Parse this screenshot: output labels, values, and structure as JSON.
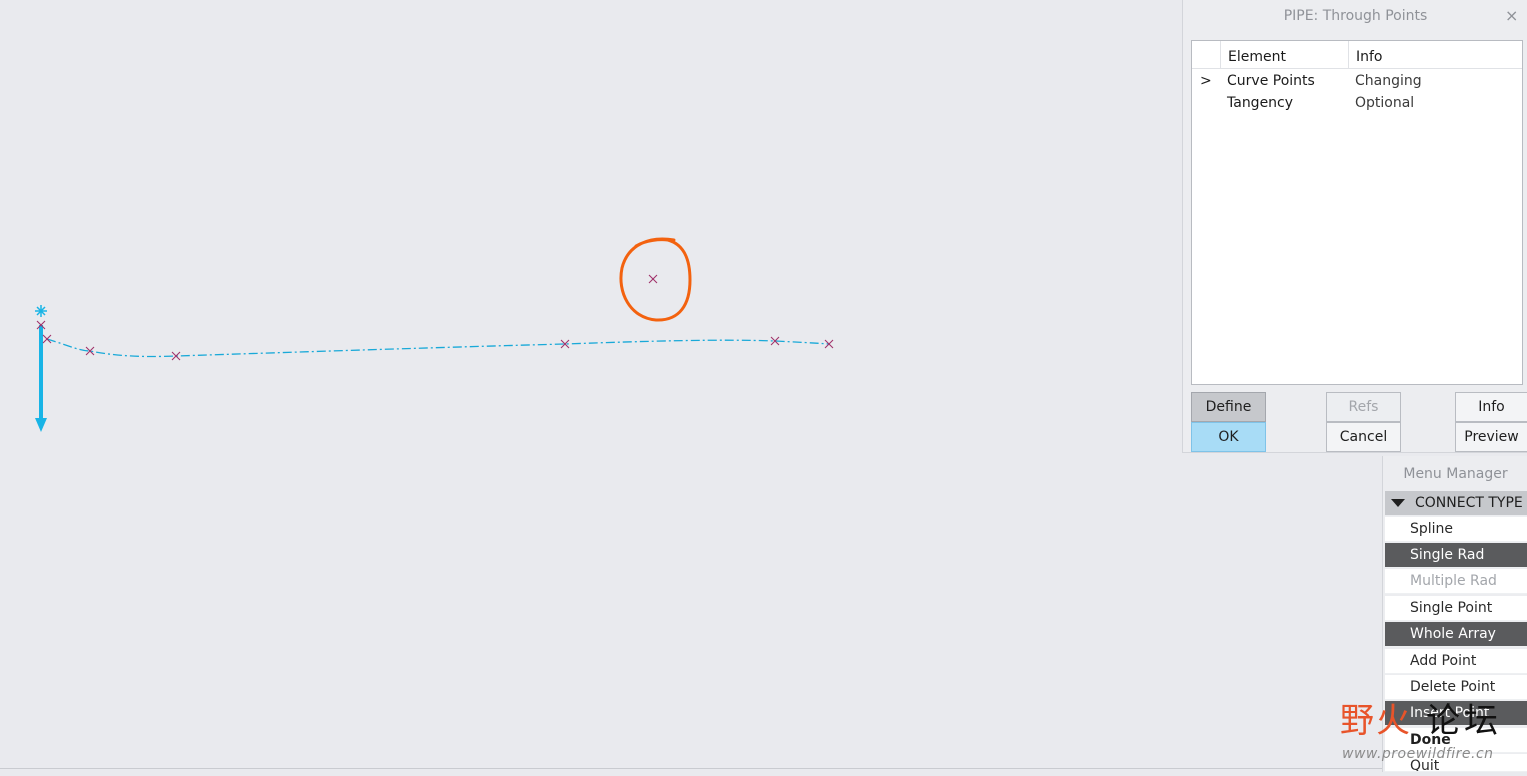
{
  "dialog": {
    "title": "PIPE: Through Points",
    "close_glyph": "×",
    "columns": [
      "Element",
      "Info"
    ],
    "rows": [
      {
        "marker": ">",
        "element": "Curve Points",
        "info": "Changing"
      },
      {
        "marker": "",
        "element": "Tangency",
        "info": "Optional"
      }
    ],
    "buttons": {
      "define": "Define",
      "refs": "Refs",
      "info": "Info",
      "ok": "OK",
      "cancel": "Cancel",
      "preview": "Preview"
    }
  },
  "menu_manager": {
    "title": "Menu Manager",
    "section": "CONNECT TYPE",
    "items": [
      {
        "label": "Spline",
        "state": "normal"
      },
      {
        "label": "Single Rad",
        "state": "selected"
      },
      {
        "label": "Multiple Rad",
        "state": "disabled"
      },
      {
        "label": "Single Point",
        "state": "normal"
      },
      {
        "label": "Whole Array",
        "state": "selected"
      },
      {
        "label": "Add Point",
        "state": "normal"
      },
      {
        "label": "Delete Point",
        "state": "normal"
      },
      {
        "label": "Insert Point",
        "state": "selected"
      },
      {
        "label": "Done",
        "state": "bold"
      },
      {
        "label": "Quit",
        "state": "normal"
      }
    ]
  },
  "watermark": {
    "chars": [
      "野",
      "火",
      "论",
      "坛"
    ],
    "url": "www.proewildfire.cn"
  },
  "colors": {
    "curve": "#19a9d8",
    "point_marker": "#a0306a",
    "annotation_circle": "#f3620f",
    "arrow": "#18b4e6",
    "selected_item": "#5a5b5d",
    "ok_button": "#a8dcf6"
  },
  "icons": {
    "close": "close-icon",
    "row_marker": "chevron-right-icon",
    "section_toggle": "triangle-down-icon"
  }
}
